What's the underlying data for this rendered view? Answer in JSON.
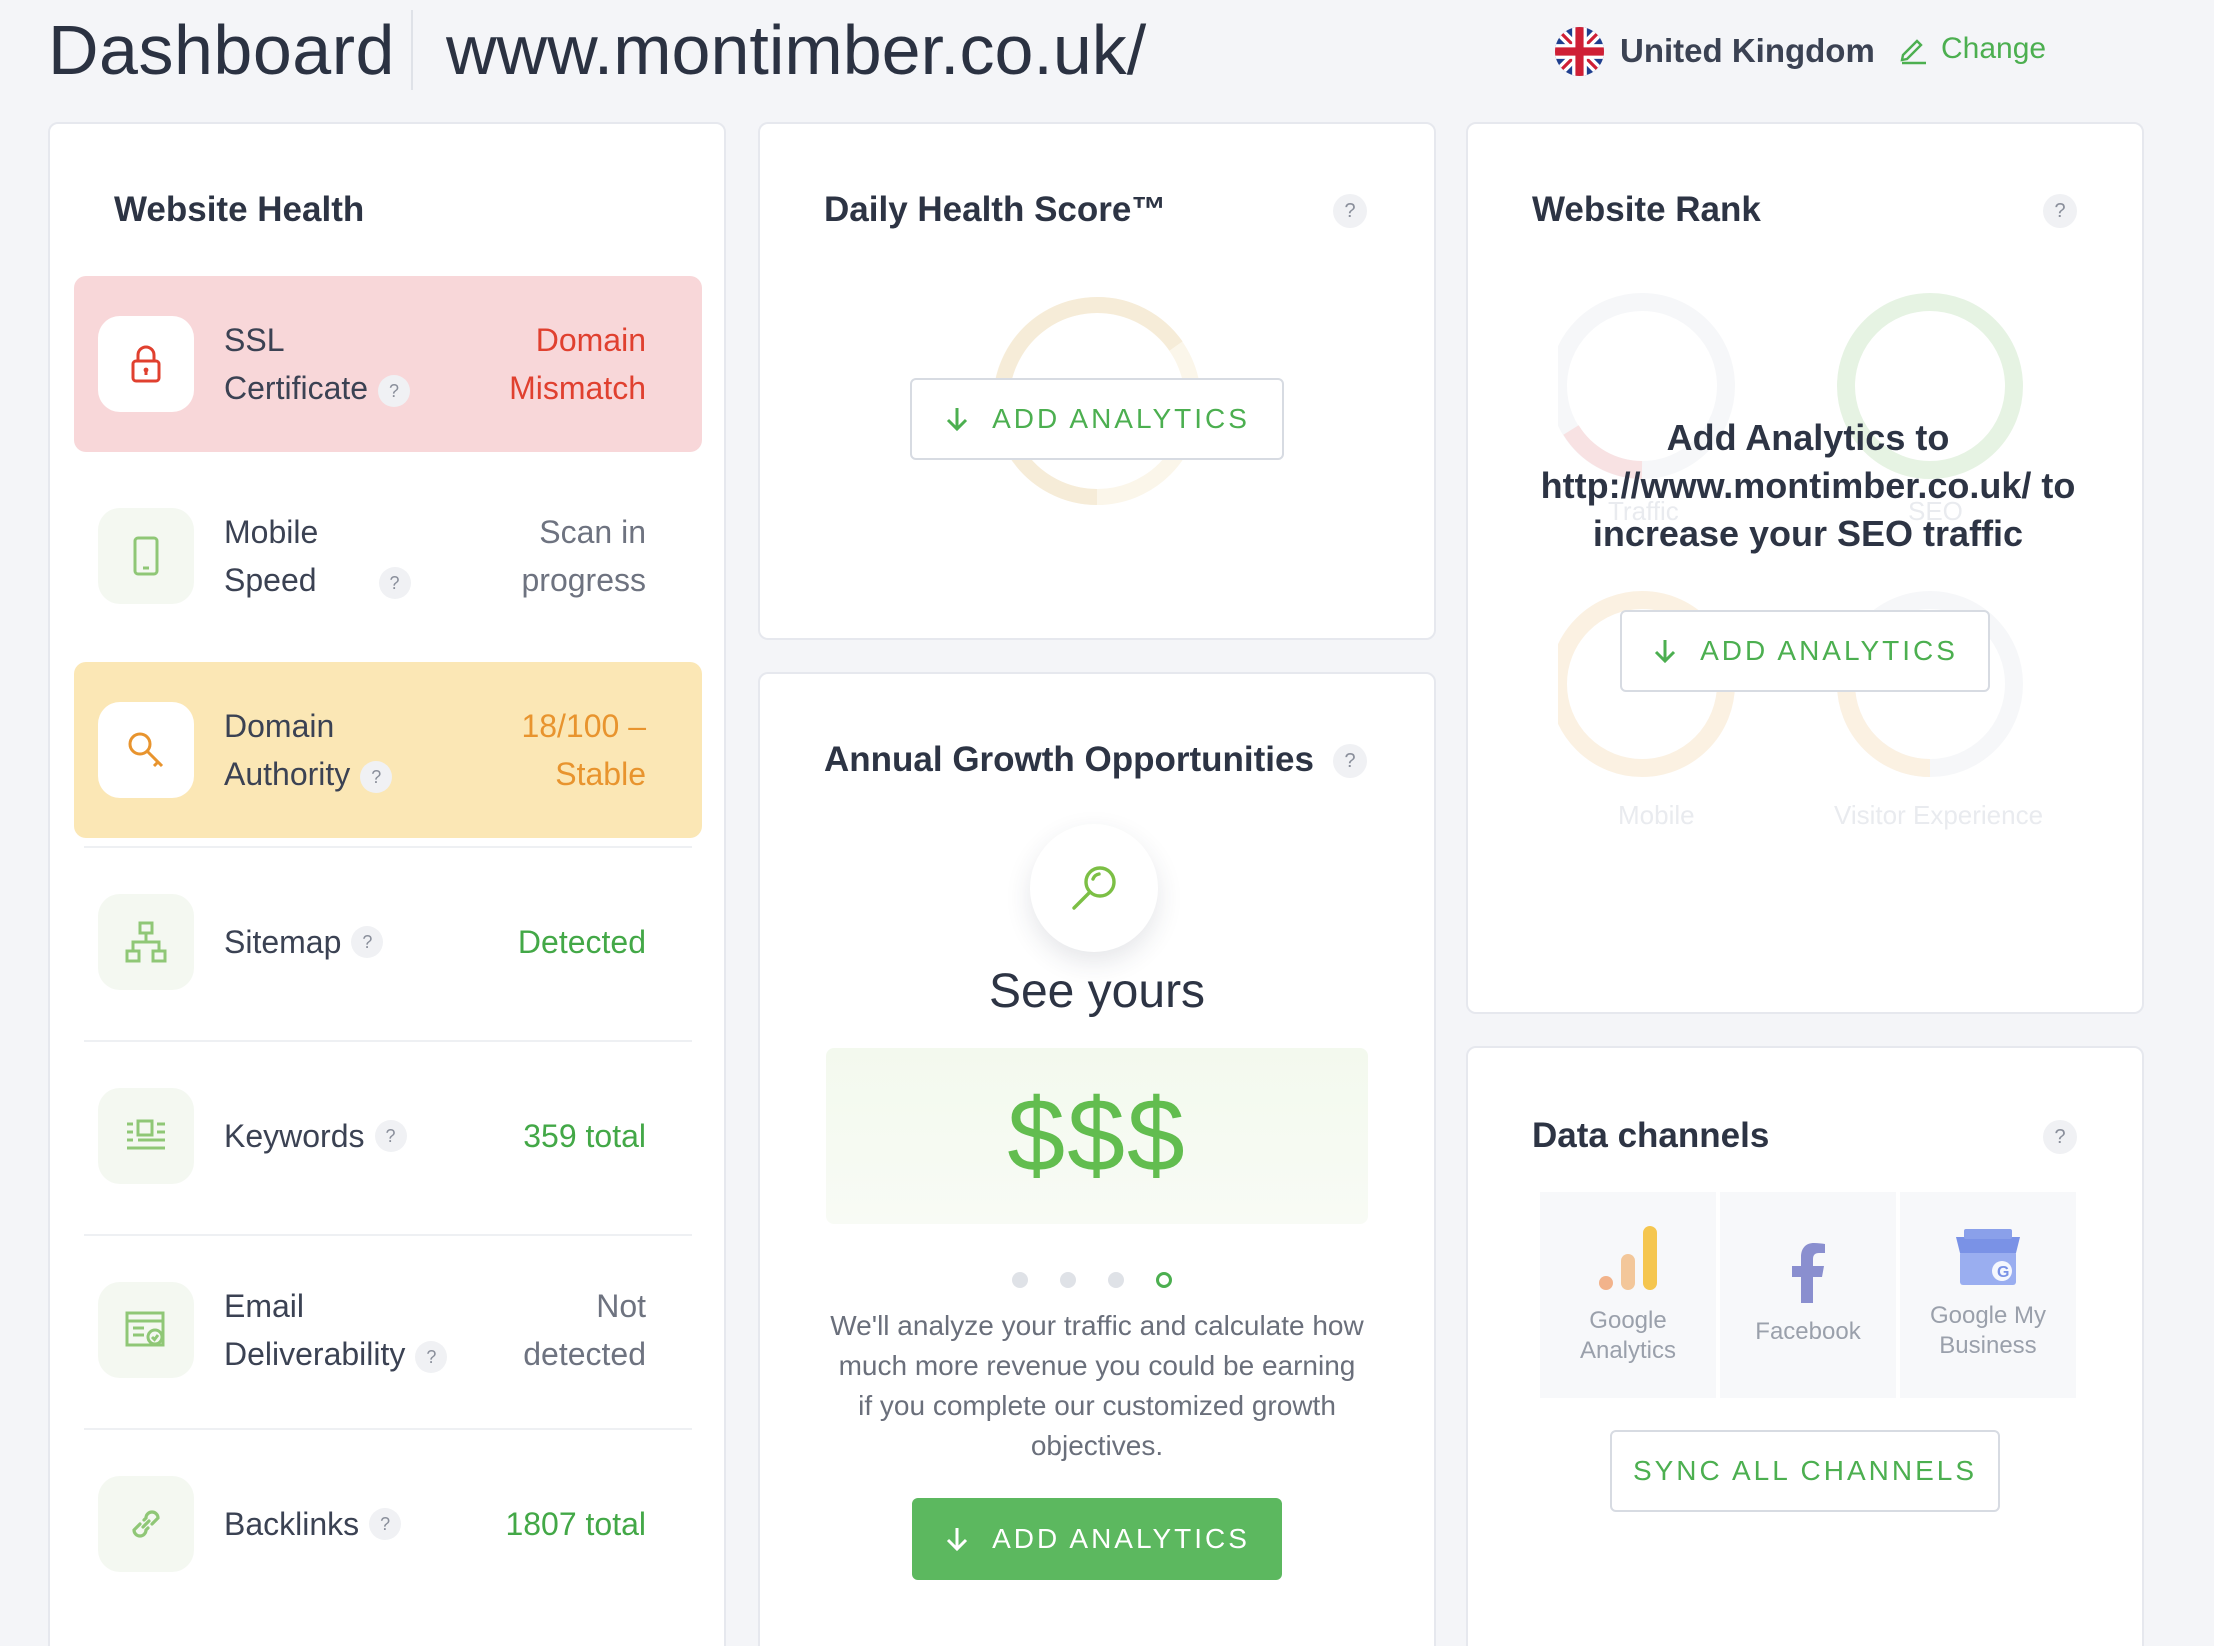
{
  "header": {
    "title": "Dashboard",
    "url": "www.montimber.co.uk/",
    "country": "United Kingdom",
    "change_label": "Change"
  },
  "website_health": {
    "title": "Website Health",
    "rows": [
      {
        "label_line1": "SSL",
        "label_line2": "Certificate",
        "value_line1": "Domain",
        "value_line2": "Mismatch",
        "status": "error",
        "icon": "lock-icon"
      },
      {
        "label_line1": "Mobile",
        "label_line2": "Speed",
        "value_line1": "Scan in",
        "value_line2": "progress",
        "status": "pending",
        "icon": "mobile-icon"
      },
      {
        "label_line1": "Domain",
        "label_line2": "Authority",
        "value_line1": "18/100 –",
        "value_line2": "Stable",
        "status": "warning",
        "icon": "magnifier-icon"
      },
      {
        "label": "Sitemap",
        "value": "Detected",
        "status": "ok",
        "icon": "sitemap-icon"
      },
      {
        "label": "Keywords",
        "value": "359 total",
        "status": "ok",
        "icon": "keywords-icon"
      },
      {
        "label_line1": "Email",
        "label_line2": "Deliverability",
        "value_line1": "Not",
        "value_line2": "detected",
        "status": "pending",
        "icon": "email-icon"
      },
      {
        "label": "Backlinks",
        "value": "1807 total",
        "status": "ok",
        "icon": "link-icon"
      }
    ]
  },
  "daily_health": {
    "title": "Daily Health Score™",
    "button": "ADD ANALYTICS"
  },
  "website_rank": {
    "title": "Website Rank",
    "message_line1": "Add Analytics to",
    "message_line2": "http://www.montimber.co.uk/ to",
    "message_line3": "increase your SEO traffic",
    "button": "ADD ANALYTICS",
    "ghost_labels": [
      "Traffic",
      "SEO",
      "Mobile",
      "Visitor Experience"
    ]
  },
  "growth": {
    "title": "Annual Growth Opportunities",
    "headline": "See yours",
    "amount": "$$$",
    "description": "We'll analyze your traffic and calculate how much more revenue you could be earning if you complete our customized growth objectives.",
    "button": "ADD ANALYTICS",
    "carousel_active_index": 3
  },
  "data_channels": {
    "title": "Data channels",
    "channels": [
      {
        "line1": "Google",
        "line2": "Analytics",
        "icon": "google-analytics-icon"
      },
      {
        "line1": "Facebook",
        "icon": "facebook-icon"
      },
      {
        "line1": "Google My",
        "line2": "Business",
        "icon": "google-my-business-icon"
      }
    ],
    "button": "SYNC ALL CHANNELS"
  },
  "help_glyph": "?",
  "colors": {
    "accent_green": "#4caf50",
    "error_red": "#e0402f",
    "warning_orange": "#e8942e",
    "error_bg": "#f8d7d9",
    "warning_bg": "#fbe7b5"
  }
}
